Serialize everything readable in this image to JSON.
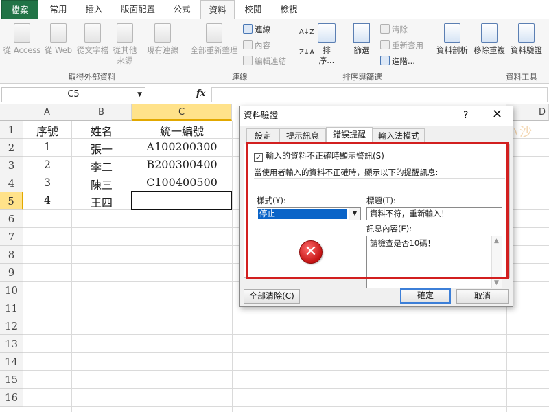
{
  "ribbon_tabs": [
    "檔案",
    "常用",
    "插入",
    "版面配置",
    "公式",
    "資料",
    "校閱",
    "檢視"
  ],
  "active_tab": "資料",
  "ribbon": {
    "external_group": {
      "label": "取得外部資料",
      "buttons": [
        "從 Access",
        "從 Web",
        "從文字檔",
        "從其他",
        "來源",
        "現有連線"
      ]
    },
    "connections_group": {
      "label": "連線",
      "refresh_all": "全部重新整理",
      "items": [
        "連線",
        "內容",
        "編輯連結"
      ]
    },
    "sort_group": {
      "label": "排序與篩選",
      "sort_az": "A↓Z",
      "sort_za": "Z↓A",
      "sort": "排序...",
      "filter": "篩選",
      "items": [
        "清除",
        "重新套用",
        "進階..."
      ]
    },
    "data_tools_group": {
      "label": "資料工具",
      "buttons": [
        "資料剖析",
        "移除重複",
        "資料驗證"
      ]
    }
  },
  "formula_bar": {
    "name_box": "C5",
    "fx": "fx",
    "value": ""
  },
  "columns": [
    "A",
    "B",
    "C",
    "D"
  ],
  "rows": [
    "1",
    "2",
    "3",
    "4",
    "5",
    "6",
    "7",
    "8",
    "9",
    "10",
    "11",
    "12",
    "13",
    "14",
    "15",
    "16"
  ],
  "sheet": {
    "header": [
      "序號",
      "姓名",
      "統一編號"
    ],
    "data": [
      [
        "1",
        "張一",
        "A100200300"
      ],
      [
        "2",
        "李二",
        "B200300400"
      ],
      [
        "3",
        "陳三",
        "C100400500"
      ],
      [
        "4",
        "王四",
        ""
      ]
    ]
  },
  "dialog": {
    "title": "資料驗證",
    "help": "?",
    "close": "✕",
    "tabs": [
      "設定",
      "提示訊息",
      "錯誤提醒",
      "輸入法模式"
    ],
    "active_tab": "錯誤提醒",
    "show_error_checkbox": "輸入的資料不正確時顯示警訊(S)",
    "show_error_checked": true,
    "description": "當使用者輸入的資料不正確時，顯示以下的提醒訊息:",
    "style_label": "樣式(Y):",
    "style_value": "停止",
    "title_label": "標題(T):",
    "title_value": "資料不符，重新輸入！",
    "message_label": "訊息內容(E):",
    "message_value": "請檢查是否10碼！",
    "clear_all": "全部清除(C)",
    "ok": "確定",
    "cancel": "取消"
  },
  "watermark": "羅傑小沙",
  "colors": {
    "file_tab": "#217346",
    "selected_header": "#ffe28a",
    "highlight_frame": "#d21f1f",
    "select_highlight": "#0a64c8"
  }
}
